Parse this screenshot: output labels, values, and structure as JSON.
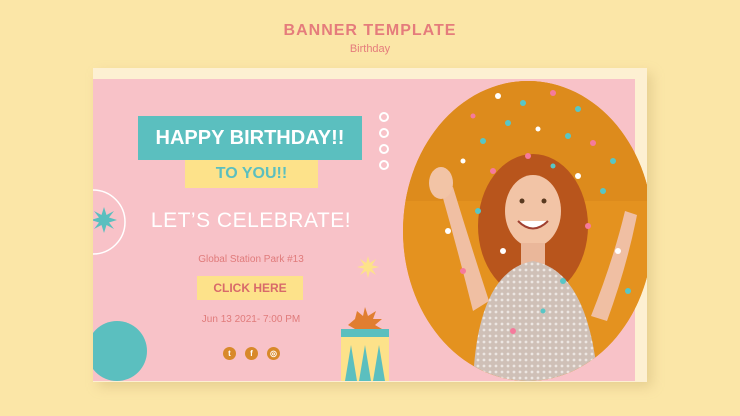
{
  "header": {
    "title": "BANNER TEMPLATE",
    "subtitle": "Birthday"
  },
  "banner": {
    "headline": "HAPPY BIRTHDAY!!",
    "subheadline": "TO YOU!!",
    "tagline": "LET’S CELEBRATE!",
    "location": "Global Station Park #13",
    "cta_label": "CLICK HERE",
    "date": "Jun 13 2021- 7:00 PM",
    "social": [
      {
        "icon": "twitter-icon",
        "glyph": "t"
      },
      {
        "icon": "facebook-icon",
        "glyph": "f"
      },
      {
        "icon": "instagram-icon",
        "glyph": "◎"
      }
    ]
  },
  "colors": {
    "page_bg": "#fbe6a7",
    "card_bg": "#fdf0d2",
    "pink": "#f8c2c8",
    "teal": "#5bbfbf",
    "yellow": "#fde28a",
    "coral": "#e57c7c",
    "photo_orange": "#e4921f"
  },
  "photo": {
    "subject": "smiling woman with red curly hair in sequin dress under falling confetti"
  }
}
